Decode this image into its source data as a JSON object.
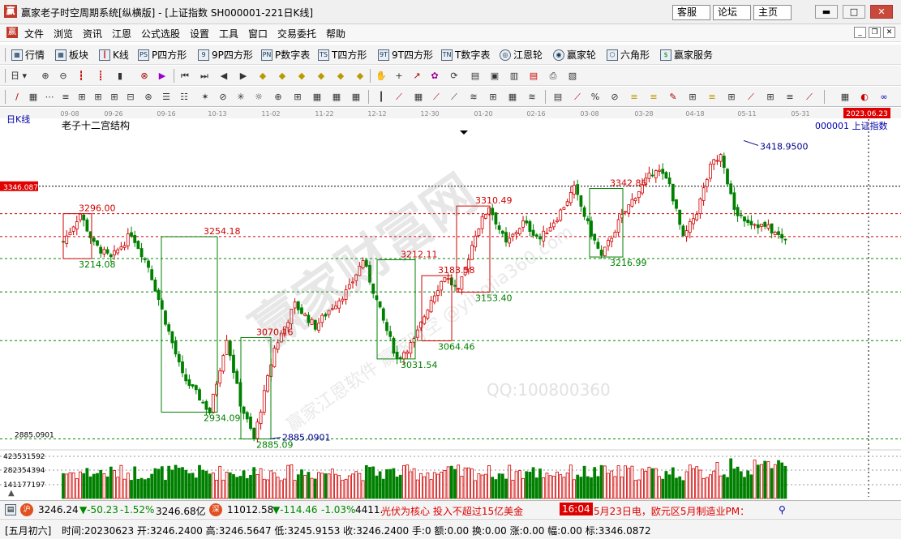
{
  "window": {
    "title": "赢家老子时空周期系统[纵横版] - [上证指数  SH000001-221日K线]",
    "buttons": [
      "客服",
      "论坛",
      "主页"
    ]
  },
  "menu": {
    "items": [
      "文件",
      "浏览",
      "资讯",
      "江恩",
      "公式选股",
      "设置",
      "工具",
      "窗口",
      "交易委托",
      "帮助"
    ]
  },
  "toolbar1": {
    "items": [
      {
        "label": "行情",
        "icon": "quote-icon"
      },
      {
        "label": "板块",
        "icon": "sector-icon"
      },
      {
        "label": "K线",
        "icon": "kline-icon"
      },
      {
        "label": "P四方形",
        "icon": "p-square-icon"
      },
      {
        "label": "9P四方形",
        "icon": "9p-square-icon"
      },
      {
        "label": "P数字表",
        "icon": "p-number-icon"
      },
      {
        "label": "T四方形",
        "icon": "t-square-icon"
      },
      {
        "label": "9T四方形",
        "icon": "9t-square-icon"
      },
      {
        "label": "T数字表",
        "icon": "t-number-icon"
      },
      {
        "label": "江恩轮",
        "icon": "gann-wheel-icon"
      },
      {
        "label": "赢家轮",
        "icon": "winner-wheel-icon"
      },
      {
        "label": "六角形",
        "icon": "hexagon-icon"
      },
      {
        "label": "赢家服务",
        "icon": "service-icon"
      }
    ]
  },
  "toolbar2": {
    "period_label": "日"
  },
  "chart_data": {
    "type": "candlestick",
    "title": "老子十二宫结构",
    "period_label": "日K线",
    "symbol_label": "000001  上证指数",
    "date_ticks": [
      "09-08",
      "09-26",
      "09-16",
      "10-13",
      "11-02",
      "11-22",
      "12-12",
      "12-30",
      "01-20",
      "02-16",
      "03-08",
      "03-28",
      "04-18",
      "05-11",
      "05-31"
    ],
    "current_date": "2023.06.23",
    "price_axis": {
      "current": "3346.0872",
      "low": "2885.0901"
    },
    "volume_axis": [
      "423531592",
      "282354394",
      "141177197"
    ],
    "annotations": [
      {
        "text": "3296.00",
        "tone": "up"
      },
      {
        "text": "3214.08",
        "tone": "down"
      },
      {
        "text": "3254.18",
        "tone": "up"
      },
      {
        "text": "2934.09",
        "tone": "down"
      },
      {
        "text": "3070.16",
        "tone": "up"
      },
      {
        "text": "2885.09",
        "tone": "down"
      },
      {
        "text": "2885.0901",
        "tone": "blue"
      },
      {
        "text": "3212.11",
        "tone": "up"
      },
      {
        "text": "3031.54",
        "tone": "down"
      },
      {
        "text": "3064.46",
        "tone": "down"
      },
      {
        "text": "3183.58",
        "tone": "up"
      },
      {
        "text": "3153.40",
        "tone": "down"
      },
      {
        "text": "3310.49",
        "tone": "up"
      },
      {
        "text": "3342.86",
        "tone": "up"
      },
      {
        "text": "3216.99",
        "tone": "down"
      },
      {
        "text": "3418.9500",
        "tone": "blue"
      }
    ],
    "watermarks": [
      "赢家财富网",
      "赢家江恩软件  赢家时空  @yingjia360.com",
      "QQ:100800360"
    ],
    "colors": {
      "up": "#d00000",
      "down": "#008000",
      "annotation_blue": "#00008b",
      "current_price_bg": "#e00000"
    }
  },
  "status1": {
    "sh_value": "3246.24",
    "sh_change": "▼-50.23",
    "sh_pct": "-1.52%",
    "sh_amount": "3246.68亿",
    "sz_value": "11012.58",
    "sz_change": "▼-114.46",
    "sz_pct": "-1.03%",
    "sz_amount": "4411.",
    "news": "光伏为核心 投入不超过15亿美金",
    "time": "16:04",
    "news2": "5月23日电，欧元区5月制造业PM："
  },
  "status2": {
    "lunar": "[五月初六]",
    "fields": "时间:20230623 开:3246.2400 高:3246.5647 低:3245.9153 收:3246.2400 手:0 额:0.00 换:0.00 涨:0.00 幅:0.00 标:3346.0872"
  }
}
